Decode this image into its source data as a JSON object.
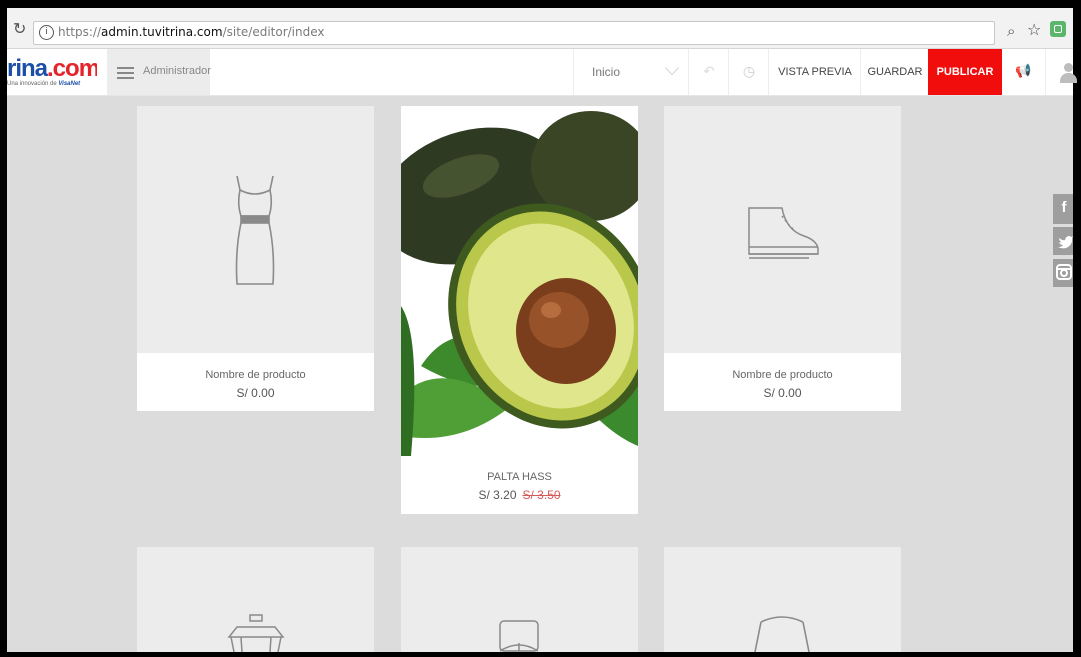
{
  "browser": {
    "url_scheme": "https://",
    "url_host": "admin.tuvitrina.com",
    "url_path": "/site/editor/index",
    "reload_icon": "reload-icon",
    "info_icon": "info-icon",
    "zoom_icon": "zoom-icon",
    "star_icon": "star-icon",
    "extension_icon": "extension-icon"
  },
  "header": {
    "logo_text_main": "rina",
    "logo_text_dot": ".com",
    "logo_sub_prefix": "Una innovación de",
    "logo_sub_brand": "VisaNet",
    "admin_label": "Administrador",
    "page_select": "Inicio",
    "preview_label": "VISTA PREVIA",
    "save_label": "GUARDAR",
    "publish_label": "PUBLICAR",
    "colors": {
      "publish": "#f20d0d",
      "brand_blue": "#1d4fa8",
      "brand_red": "#e3242b"
    }
  },
  "products": [
    {
      "name": "Nombre de producto",
      "price": "S/ 0.00",
      "icon": "dress-icon"
    },
    {
      "name": "PALTA HASS",
      "price": "S/ 3.20",
      "old_price": "S/ 3.50",
      "image": "avocado-image"
    },
    {
      "name": "Nombre de producto",
      "price": "S/ 0.00",
      "icon": "sneaker-icon"
    }
  ],
  "second_row_icons": [
    "coffee-maker-icon",
    "watch-icon",
    "bag-icon"
  ],
  "social": [
    "f",
    "twitter-icon",
    "instagram-icon"
  ]
}
